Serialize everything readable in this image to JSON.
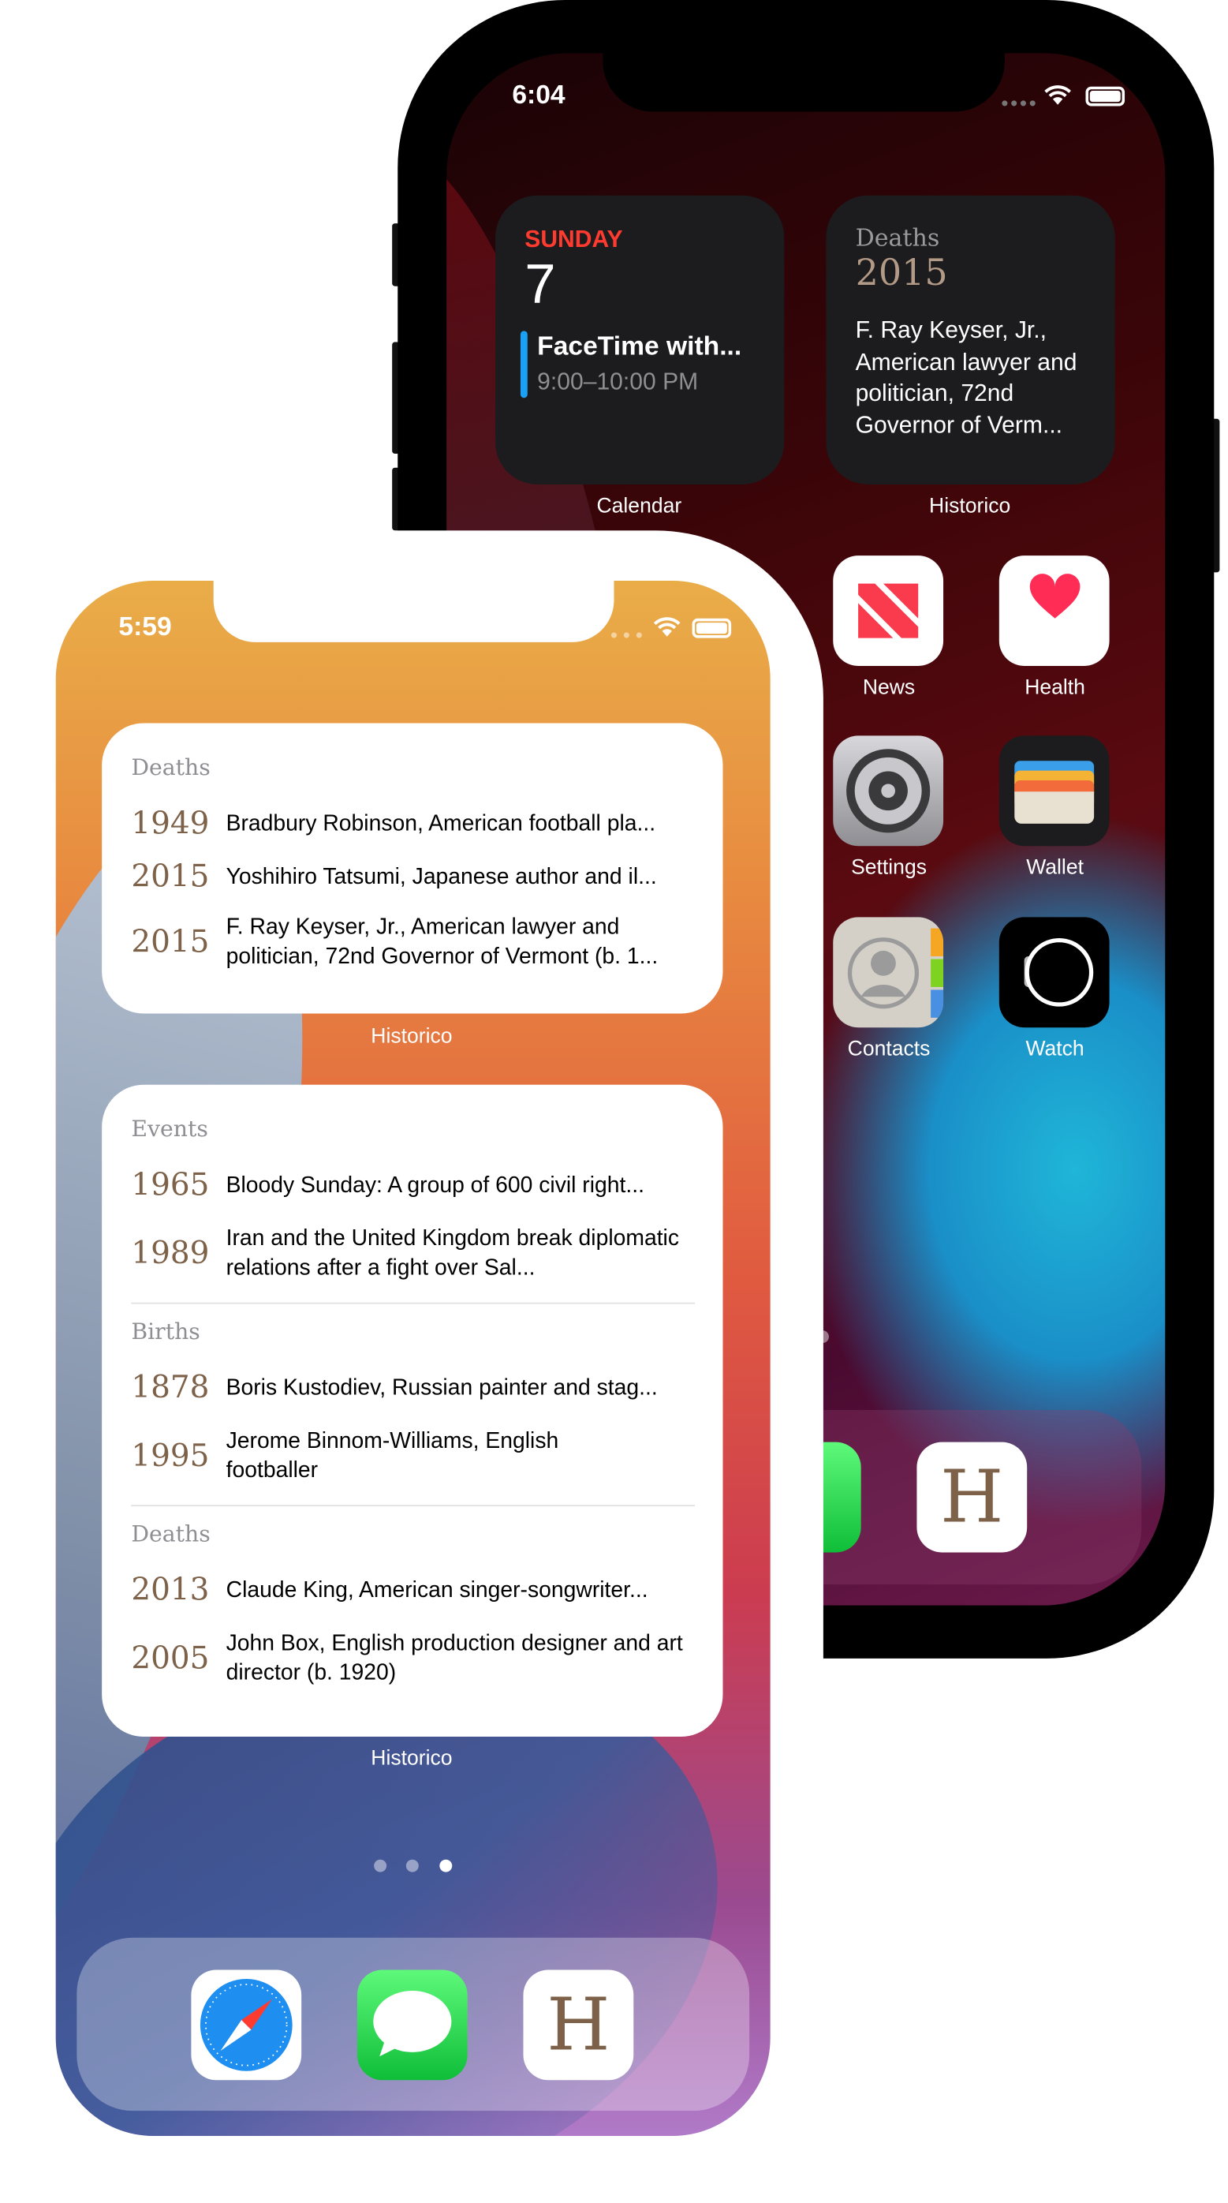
{
  "back_phone": {
    "status_time": "6:04",
    "calendar_widget": {
      "day": "SUNDAY",
      "date": "7",
      "event_title": "FaceTime with...",
      "event_time": "9:00–10:00 PM",
      "label": "Calendar"
    },
    "historico_widget": {
      "category": "Deaths",
      "year": "2015",
      "text": "F. Ray Keyser, Jr., American lawyer and politician, 72nd Governor of Verm...",
      "label": "Historico"
    },
    "apps": [
      {
        "name": "News",
        "icon": "news-icon"
      },
      {
        "name": "Health",
        "icon": "health-icon"
      },
      {
        "name": "Settings",
        "icon": "settings-icon"
      },
      {
        "name": "Wallet",
        "icon": "wallet-icon"
      },
      {
        "name": "Contacts",
        "icon": "contacts-icon"
      },
      {
        "name": "Watch",
        "icon": "watch-icon"
      }
    ],
    "dock": [
      {
        "icon": "messages-icon"
      },
      {
        "icon": "historico-icon",
        "letter": "H"
      }
    ]
  },
  "front_phone": {
    "status_time": "5:59",
    "widget_small": {
      "label": "Historico",
      "sections": [
        {
          "title": "Deaths",
          "items": [
            {
              "year": "1949",
              "text": "Bradbury Robinson, American football pla..."
            },
            {
              "year": "2015",
              "text": "Yoshihiro Tatsumi, Japanese author and il..."
            },
            {
              "year": "2015",
              "text": "F. Ray Keyser, Jr., American lawyer and politician, 72nd Governor of Vermont (b. 1..."
            }
          ]
        }
      ]
    },
    "widget_large": {
      "label": "Historico",
      "sections": [
        {
          "title": "Events",
          "items": [
            {
              "year": "1965",
              "text": "Bloody Sunday: A group of 600 civil right..."
            },
            {
              "year": "1989",
              "text": "Iran and the United Kingdom break diplomatic relations after a fight over Sal..."
            }
          ]
        },
        {
          "title": "Births",
          "items": [
            {
              "year": "1878",
              "text": "Boris Kustodiev, Russian painter and stag..."
            },
            {
              "year": "1995",
              "text": "Jerome Binnom-Williams, English footballer"
            }
          ]
        },
        {
          "title": "Deaths",
          "items": [
            {
              "year": "2013",
              "text": "Claude King, American singer-songwriter..."
            },
            {
              "year": "2005",
              "text": "John Box, English production designer and art director (b. 1920)"
            }
          ]
        }
      ]
    },
    "page_dots": {
      "count": 3,
      "active": 3
    },
    "dock": [
      {
        "icon": "safari-icon"
      },
      {
        "icon": "messages-icon"
      },
      {
        "icon": "historico-icon",
        "letter": "H"
      }
    ]
  },
  "colors": {
    "year_brown": "#7d6148",
    "calendar_red": "#ff3b30",
    "event_blue": "#1aa1f5"
  }
}
